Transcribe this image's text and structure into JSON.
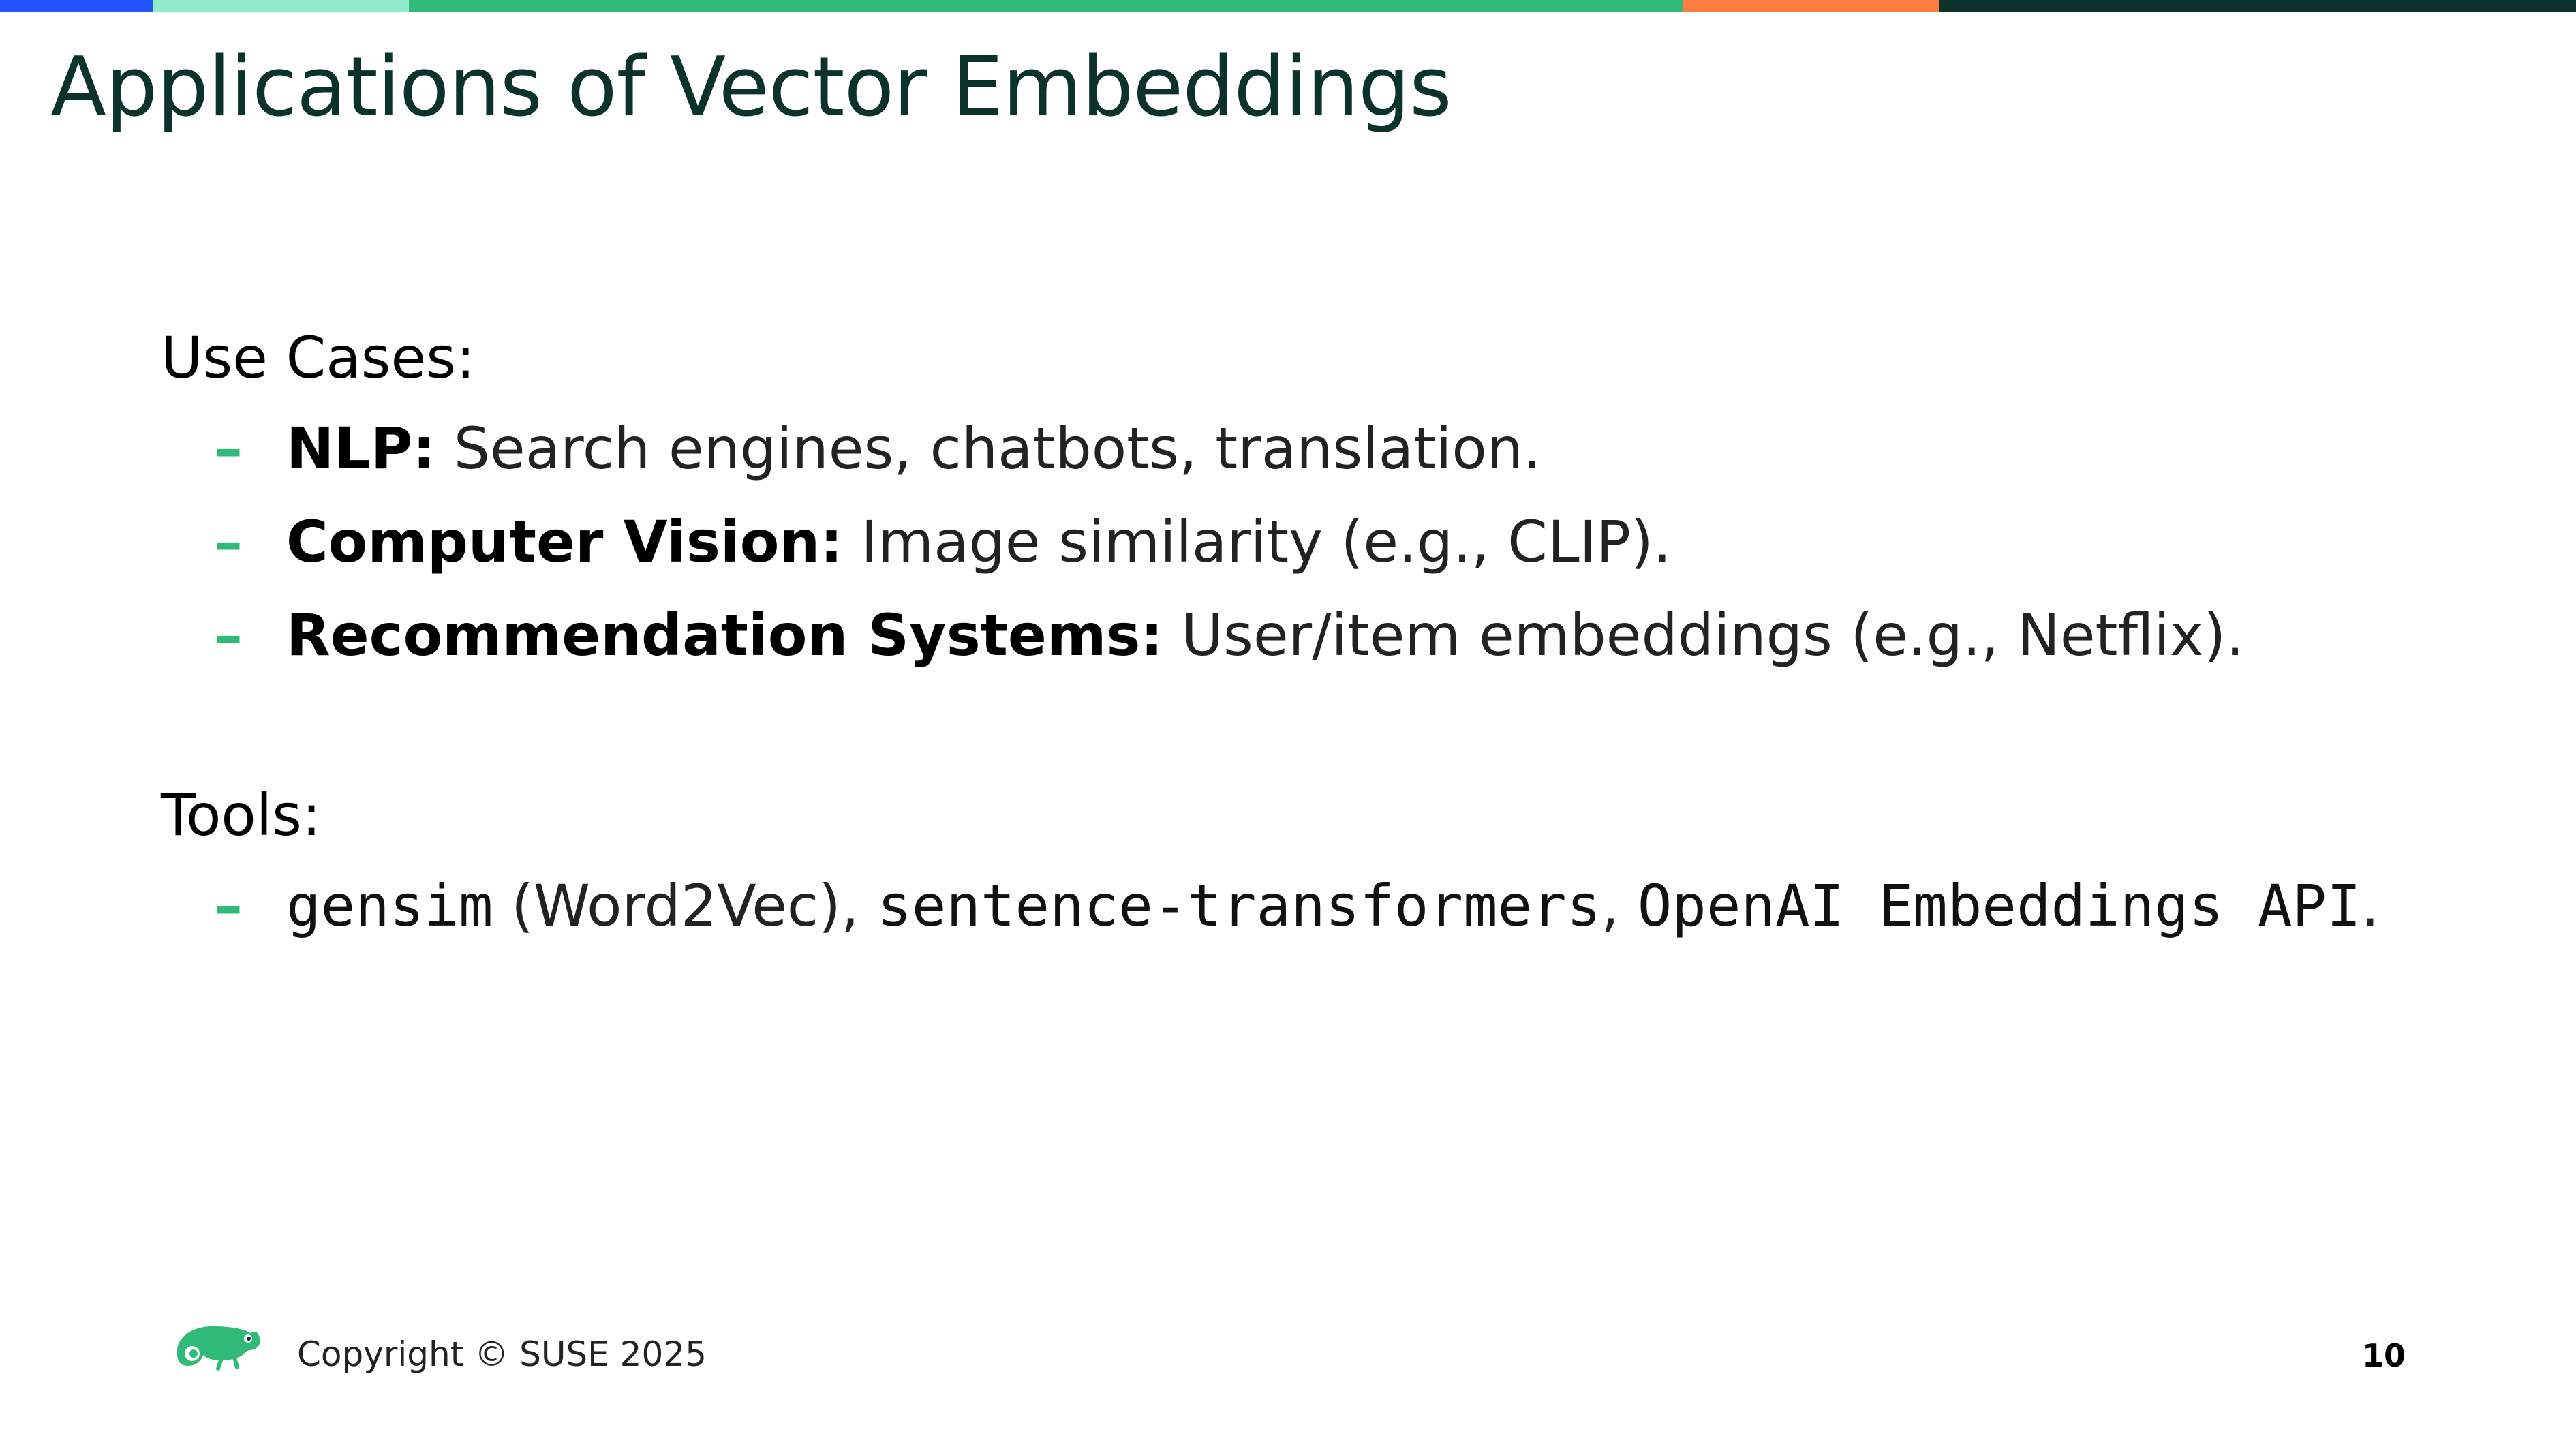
{
  "colors": {
    "accent_bar": [
      "#2453ff",
      "#90ebcd",
      "#30ba78",
      "#fe7c3f",
      "#0c322c"
    ],
    "title": "#0c322c",
    "dash": "#30ba78",
    "logo": "#30ba78"
  },
  "slide": {
    "title": "Applications of Vector Embeddings",
    "use_cases": {
      "heading": "Use Cases:",
      "items": [
        {
          "term": "NLP:",
          "desc": "Search engines, chatbots, translation."
        },
        {
          "term": "Computer Vision:",
          "desc": "Image similarity (e.g., CLIP)."
        },
        {
          "term": "Recommendation Systems:",
          "desc": "User/item embeddings (e.g., Netflix)."
        }
      ]
    },
    "tools": {
      "heading": "Tools:",
      "dash": "–",
      "tool1": "gensim",
      "tool1_note": " (Word2Vec), ",
      "tool2": "sentence-transformers",
      "sep": ", ",
      "tool3": "OpenAI Embeddings API",
      "end": "."
    }
  },
  "footer": {
    "logo_icon": "suse-chameleon-logo-icon",
    "copyright": "Copyright © SUSE 2025",
    "page_number": "10"
  }
}
